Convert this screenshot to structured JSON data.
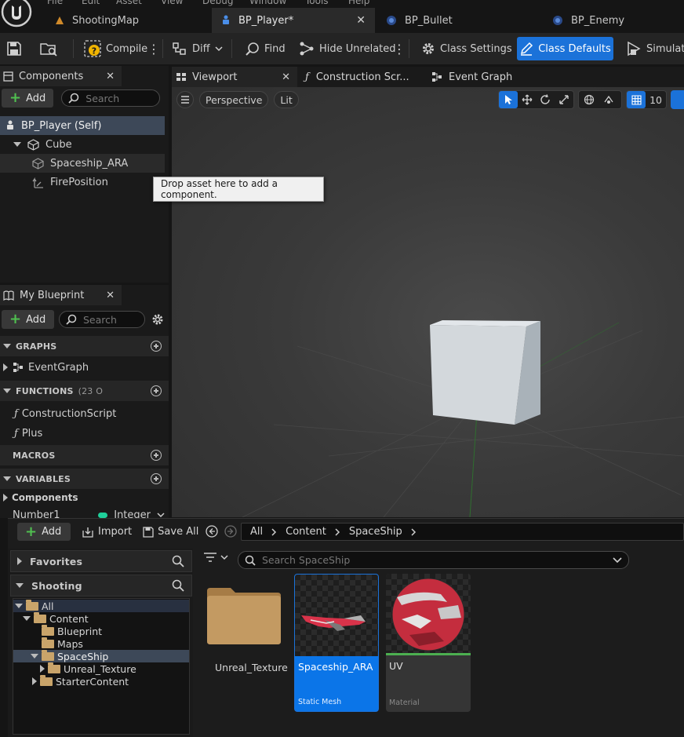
{
  "menu_fragments": [
    "File",
    "Edit",
    "Asset",
    "View",
    "Debug",
    "Window",
    "Tools",
    "Help"
  ],
  "doc_tabs": [
    {
      "label": "ShootingMap"
    },
    {
      "label": "BP_Player*"
    },
    {
      "label": "BP_Bullet"
    },
    {
      "label": "BP_Enemy"
    }
  ],
  "toolbar": {
    "compile": "Compile",
    "diff": "Diff",
    "find": "Find",
    "hide_unrelated": "Hide Unrelated",
    "class_settings": "Class Settings",
    "class_defaults": "Class Defaults",
    "simulation": "Simulation"
  },
  "components_panel": {
    "tab_label": "Components",
    "add_label": "Add",
    "search_placeholder": "Search",
    "items": [
      {
        "label": "BP_Player (Self)"
      },
      {
        "label": "Cube"
      },
      {
        "label": "Spaceship_ARA"
      },
      {
        "label": "FirePosition"
      }
    ],
    "tooltip": "Drop asset here to add a component."
  },
  "my_blueprint": {
    "tab_label": "My Blueprint",
    "add_label": "Add",
    "search_placeholder": "Search",
    "graphs_header": "GRAPHS",
    "graph_item": "EventGraph",
    "functions_header": "FUNCTIONS",
    "functions_count": "(23 O",
    "function_items": [
      "ConstructionScript",
      "Plus"
    ],
    "macros_header": "MACROS",
    "variables_header": "VARIABLES",
    "components_label": "Components",
    "variable_name": "Number1",
    "variable_type": "Integer"
  },
  "editor_tabs": [
    {
      "label": "Viewport"
    },
    {
      "label": "Construction Scr..."
    },
    {
      "label": "Event Graph"
    }
  ],
  "viewport": {
    "perspective": "Perspective",
    "lit": "Lit",
    "grid_value": "10"
  },
  "content_browser": {
    "add_label": "Add",
    "import_label": "Import",
    "save_all_label": "Save All",
    "breadcrumb": [
      "All",
      "Content",
      "SpaceShip"
    ],
    "favorites_label": "Favorites",
    "shooting_label": "Shooting",
    "search_placeholder": "Search SpaceShip",
    "tree": [
      {
        "label": "All"
      },
      {
        "label": "Content"
      },
      {
        "label": "Blueprint"
      },
      {
        "label": "Maps"
      },
      {
        "label": "SpaceShip"
      },
      {
        "label": "Unreal_Texture"
      },
      {
        "label": "StarterContent"
      }
    ],
    "assets": [
      {
        "name": "Unreal_Texture",
        "type": ""
      },
      {
        "name": "Spaceship_ARA",
        "type": "Static Mesh"
      },
      {
        "name": "UV",
        "type": "Material"
      }
    ]
  },
  "colors": {
    "accent_blue": "#1b72d9",
    "material_green": "#4caf50",
    "add_green": "#50c050"
  }
}
